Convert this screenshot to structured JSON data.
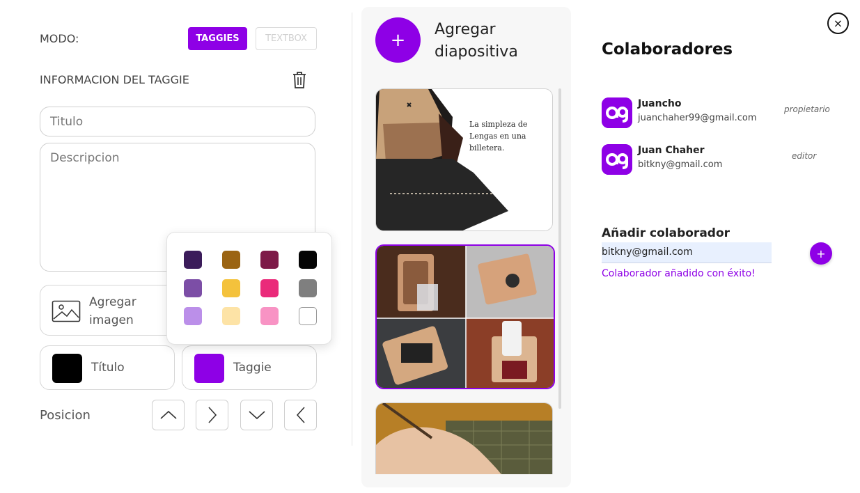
{
  "mode": {
    "label": "MODO:",
    "options": [
      "TAGGIES",
      "TEXTBOX"
    ],
    "active": "TAGGIES"
  },
  "taggie_info": {
    "label": "INFORMACION DEL TAGGIE",
    "title_placeholder": "Titulo",
    "description_placeholder": "Descripcion",
    "add_image_label": "Agregar imagen"
  },
  "colors": {
    "title_label": "Título",
    "title_color": "#000000",
    "taggie_label": "Taggie",
    "taggie_color": "#8e00e6",
    "palette": [
      [
        "#3b1c5a",
        "#9b6413",
        "#7d1a48",
        "#050505"
      ],
      [
        "#7c4ea6",
        "#f4c23c",
        "#ea2a7a",
        "#7f7f7f"
      ],
      [
        "#bb8fe9",
        "#fde3a6",
        "#f893c4",
        "#ffffff"
      ]
    ]
  },
  "position": {
    "label": "Posicion",
    "buttons": [
      "up",
      "right",
      "down",
      "left"
    ]
  },
  "slides_panel": {
    "add_label": "Agregar diapositiva",
    "add_icon": "+",
    "slide1_caption": "La simpleza de Lengas en una billetera."
  },
  "collaborators": {
    "title": "Colaboradores",
    "list": [
      {
        "name": "Juancho",
        "email": "juanchaher99@gmail.com",
        "role": "propietario"
      },
      {
        "name": "Juan Chaher",
        "email": "bitkny@gmail.com",
        "role": "editor"
      }
    ],
    "add_title": "Añadir colaborador",
    "add_input_value": "bitkny@gmail.com",
    "add_button": "+",
    "success_message": "Colaborador añadido con éxito!"
  },
  "close_icon": "×",
  "accent_color": "#8e00e6"
}
